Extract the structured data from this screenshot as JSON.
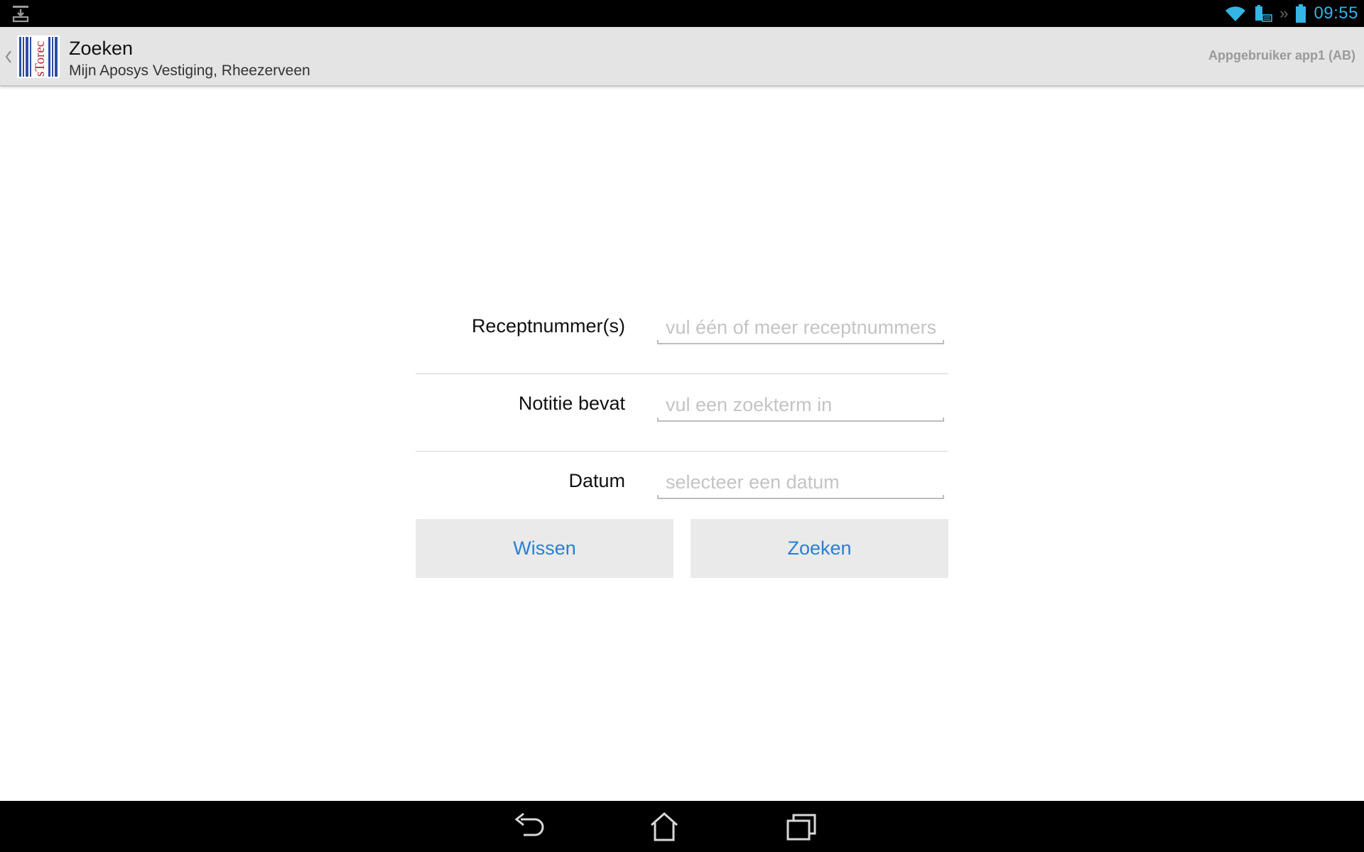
{
  "status_bar": {
    "time": "09:55",
    "icons": [
      "download-notification-icon",
      "wifi-icon",
      "keyboard-battery-icon",
      "fast-forward-icon",
      "battery-icon"
    ],
    "accent_color": "#33b5e5"
  },
  "action_bar": {
    "logo_text": "sTorec",
    "title": "Zoeken",
    "subtitle": "Mijn Aposys Vestiging, Rheezerveen",
    "user": "Appgebruiker app1 (AB)"
  },
  "form": {
    "fields": [
      {
        "label": "Receptnummer(s)",
        "placeholder": "vul één of meer receptnummers",
        "value": ""
      },
      {
        "label": "Notitie bevat",
        "placeholder": "vul een zoekterm in",
        "value": ""
      },
      {
        "label": "Datum",
        "placeholder": "selecteer een datum",
        "value": ""
      }
    ],
    "clear_label": "Wissen",
    "search_label": "Zoeken",
    "button_text_color": "#2a7fcf"
  },
  "nav_bar": {
    "icons": [
      "back-icon",
      "home-icon",
      "recent-apps-icon"
    ]
  }
}
